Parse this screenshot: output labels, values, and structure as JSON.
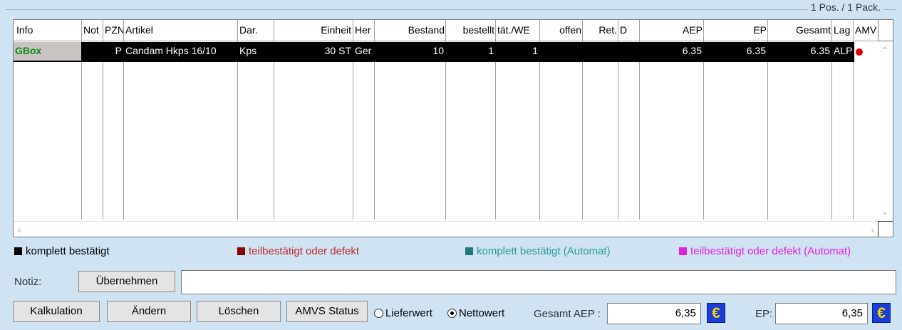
{
  "position_count": "1 Pos. / 1 Pack.",
  "columns": [
    "Info",
    "Not",
    "PZN",
    "Artikel",
    "Dar.",
    "Einheit",
    "Her",
    "Bestand",
    "bestellt",
    "tät./WE",
    "offen",
    "Ret.",
    "D",
    "AEP",
    "EP",
    "Gesamt",
    "Lag",
    "AMV"
  ],
  "row": {
    "info": "GBox",
    "not": "",
    "pzn": "P",
    "artikel": "Candam Hkps 16/10",
    "dar": "Kps",
    "einheit": "30 ST",
    "her": "Ger",
    "bestand": "10",
    "bestellt": "1",
    "taet_we": "1",
    "offen": "",
    "ret": "",
    "d": "",
    "aep": "6.35",
    "ep": "6.35",
    "gesamt": "6.35",
    "lag": "ALP",
    "amv": ""
  },
  "legend": [
    {
      "label": "komplett bestätigt",
      "color": "#000000",
      "text_color": "#000000"
    },
    {
      "label": "teilbestätigt oder defekt",
      "color": "#8b0000",
      "text_color": "#c0282d"
    },
    {
      "label": "komplett bestätigt (Automat)",
      "color": "#1f7a7a",
      "text_color": "#2a9b9b"
    },
    {
      "label": "teilbestätigt oder defekt (Automat)",
      "color": "#e020e0",
      "text_color": "#e020e0"
    }
  ],
  "notiz": {
    "label": "Notiz:",
    "button": "Übernehmen",
    "value": ""
  },
  "buttons": {
    "kalkulation": "Kalkulation",
    "aendern": "Ändern",
    "loeschen": "Löschen",
    "amvs_status": "AMVS Status"
  },
  "radio": {
    "lieferwert": {
      "label": "Lieferwert",
      "checked": false
    },
    "nettowert": {
      "label": "Nettowert",
      "checked": true
    }
  },
  "totals": {
    "gesamt_aep_label": "Gesamt AEP :",
    "gesamt_aep_value": "6,35",
    "ep_label": "EP:",
    "ep_value": "6,35",
    "currency_symbol": "€"
  },
  "colors": {
    "background": "#cfe3f3",
    "selected_row": "#000000",
    "info_cell_text": "#0b8a1a",
    "status_dot": "#e00000",
    "euro_button": "#1a3ed6"
  }
}
